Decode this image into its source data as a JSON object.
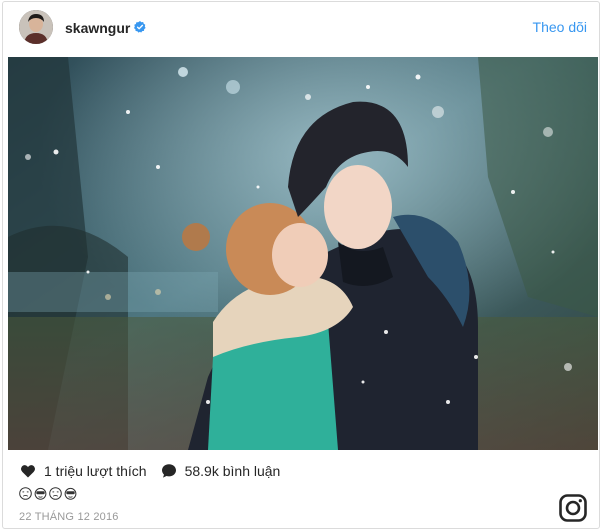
{
  "post": {
    "username": "skawngur",
    "follow_label": "Theo dõi",
    "likes_label": "1 triệu lượt thích",
    "comments_label": "58.9k bình luận",
    "date": "22 THÁNG 12 2016",
    "caption_emoji": [
      "crying-face",
      "monkey-face",
      "crying-face",
      "monkey-face"
    ]
  },
  "icons": {
    "verified": "verified-badge-icon",
    "like": "heart-icon",
    "comment": "comment-bubble-icon",
    "brand": "instagram-logo-icon"
  },
  "colors": {
    "link_blue": "#3897f0",
    "verified_blue": "#3897f0",
    "text_dark": "#262626",
    "meta_gray": "#999999",
    "border": "#dbdbdb"
  }
}
